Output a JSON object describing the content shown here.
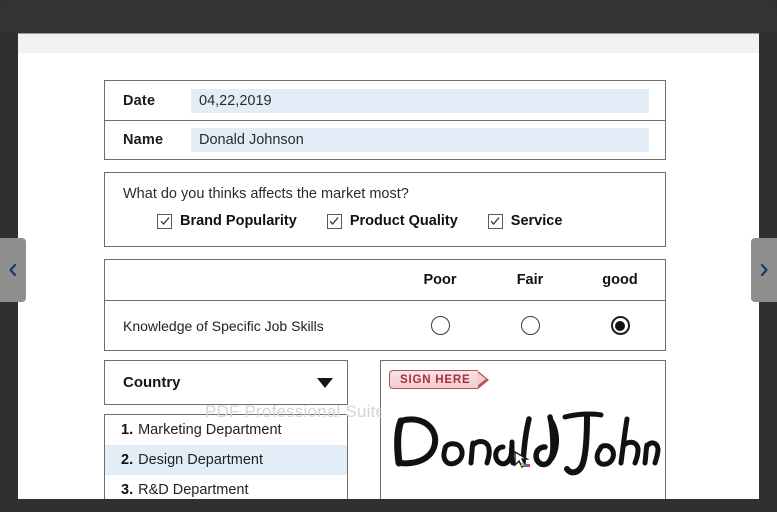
{
  "viewer": {
    "prev_page_icon": "chevron-left-icon",
    "next_page_icon": "chevron-right-icon"
  },
  "form": {
    "identity": {
      "rows": [
        {
          "label": "Date",
          "value": "04,22,2019"
        },
        {
          "label": "Name",
          "value": "Donald Johnson"
        }
      ]
    },
    "question": {
      "text": "What do you thinks affects the market most?",
      "options": [
        {
          "label": "Brand Popularity",
          "checked": true
        },
        {
          "label": "Product Quality",
          "checked": true
        },
        {
          "label": "Service",
          "checked": true
        }
      ]
    },
    "rating": {
      "columns": [
        "Poor",
        "Fair",
        "good"
      ],
      "rows": [
        {
          "label": "Knowledge of Specific Job Skills",
          "selected_index": 2
        }
      ]
    },
    "dropdown": {
      "label": "Country",
      "arrow_icon": "chevron-down-icon"
    },
    "list": {
      "items": [
        {
          "number": "1.",
          "label": "Marketing Department",
          "highlighted": false
        },
        {
          "number": "2.",
          "label": "Design Department",
          "highlighted": true
        },
        {
          "number": "3.",
          "label": "R&D Department",
          "highlighted": false
        }
      ]
    },
    "signature": {
      "tag_label": "SIGN HERE",
      "signed_name": "Donald Johnson"
    }
  },
  "watermark": {
    "text": "PDF Professional Suite f"
  },
  "colors": {
    "chrome": "#323335",
    "field_highlight": "#e3edf8",
    "panel_border": "#6e6e6e",
    "sign_tag_border": "#b8525a",
    "sign_tag_text": "#a8303c",
    "nav_tab": "#8f8f8f"
  }
}
